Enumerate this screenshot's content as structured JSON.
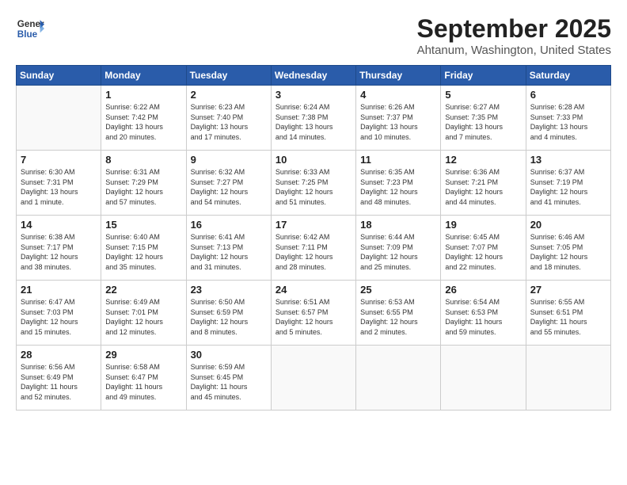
{
  "logo": {
    "general": "General",
    "blue": "Blue"
  },
  "header": {
    "title": "September 2025",
    "subtitle": "Ahtanum, Washington, United States"
  },
  "weekdays": [
    "Sunday",
    "Monday",
    "Tuesday",
    "Wednesday",
    "Thursday",
    "Friday",
    "Saturday"
  ],
  "weeks": [
    [
      {
        "day": "",
        "info": ""
      },
      {
        "day": "1",
        "info": "Sunrise: 6:22 AM\nSunset: 7:42 PM\nDaylight: 13 hours\nand 20 minutes."
      },
      {
        "day": "2",
        "info": "Sunrise: 6:23 AM\nSunset: 7:40 PM\nDaylight: 13 hours\nand 17 minutes."
      },
      {
        "day": "3",
        "info": "Sunrise: 6:24 AM\nSunset: 7:38 PM\nDaylight: 13 hours\nand 14 minutes."
      },
      {
        "day": "4",
        "info": "Sunrise: 6:26 AM\nSunset: 7:37 PM\nDaylight: 13 hours\nand 10 minutes."
      },
      {
        "day": "5",
        "info": "Sunrise: 6:27 AM\nSunset: 7:35 PM\nDaylight: 13 hours\nand 7 minutes."
      },
      {
        "day": "6",
        "info": "Sunrise: 6:28 AM\nSunset: 7:33 PM\nDaylight: 13 hours\nand 4 minutes."
      }
    ],
    [
      {
        "day": "7",
        "info": "Sunrise: 6:30 AM\nSunset: 7:31 PM\nDaylight: 13 hours\nand 1 minute."
      },
      {
        "day": "8",
        "info": "Sunrise: 6:31 AM\nSunset: 7:29 PM\nDaylight: 12 hours\nand 57 minutes."
      },
      {
        "day": "9",
        "info": "Sunrise: 6:32 AM\nSunset: 7:27 PM\nDaylight: 12 hours\nand 54 minutes."
      },
      {
        "day": "10",
        "info": "Sunrise: 6:33 AM\nSunset: 7:25 PM\nDaylight: 12 hours\nand 51 minutes."
      },
      {
        "day": "11",
        "info": "Sunrise: 6:35 AM\nSunset: 7:23 PM\nDaylight: 12 hours\nand 48 minutes."
      },
      {
        "day": "12",
        "info": "Sunrise: 6:36 AM\nSunset: 7:21 PM\nDaylight: 12 hours\nand 44 minutes."
      },
      {
        "day": "13",
        "info": "Sunrise: 6:37 AM\nSunset: 7:19 PM\nDaylight: 12 hours\nand 41 minutes."
      }
    ],
    [
      {
        "day": "14",
        "info": "Sunrise: 6:38 AM\nSunset: 7:17 PM\nDaylight: 12 hours\nand 38 minutes."
      },
      {
        "day": "15",
        "info": "Sunrise: 6:40 AM\nSunset: 7:15 PM\nDaylight: 12 hours\nand 35 minutes."
      },
      {
        "day": "16",
        "info": "Sunrise: 6:41 AM\nSunset: 7:13 PM\nDaylight: 12 hours\nand 31 minutes."
      },
      {
        "day": "17",
        "info": "Sunrise: 6:42 AM\nSunset: 7:11 PM\nDaylight: 12 hours\nand 28 minutes."
      },
      {
        "day": "18",
        "info": "Sunrise: 6:44 AM\nSunset: 7:09 PM\nDaylight: 12 hours\nand 25 minutes."
      },
      {
        "day": "19",
        "info": "Sunrise: 6:45 AM\nSunset: 7:07 PM\nDaylight: 12 hours\nand 22 minutes."
      },
      {
        "day": "20",
        "info": "Sunrise: 6:46 AM\nSunset: 7:05 PM\nDaylight: 12 hours\nand 18 minutes."
      }
    ],
    [
      {
        "day": "21",
        "info": "Sunrise: 6:47 AM\nSunset: 7:03 PM\nDaylight: 12 hours\nand 15 minutes."
      },
      {
        "day": "22",
        "info": "Sunrise: 6:49 AM\nSunset: 7:01 PM\nDaylight: 12 hours\nand 12 minutes."
      },
      {
        "day": "23",
        "info": "Sunrise: 6:50 AM\nSunset: 6:59 PM\nDaylight: 12 hours\nand 8 minutes."
      },
      {
        "day": "24",
        "info": "Sunrise: 6:51 AM\nSunset: 6:57 PM\nDaylight: 12 hours\nand 5 minutes."
      },
      {
        "day": "25",
        "info": "Sunrise: 6:53 AM\nSunset: 6:55 PM\nDaylight: 12 hours\nand 2 minutes."
      },
      {
        "day": "26",
        "info": "Sunrise: 6:54 AM\nSunset: 6:53 PM\nDaylight: 11 hours\nand 59 minutes."
      },
      {
        "day": "27",
        "info": "Sunrise: 6:55 AM\nSunset: 6:51 PM\nDaylight: 11 hours\nand 55 minutes."
      }
    ],
    [
      {
        "day": "28",
        "info": "Sunrise: 6:56 AM\nSunset: 6:49 PM\nDaylight: 11 hours\nand 52 minutes."
      },
      {
        "day": "29",
        "info": "Sunrise: 6:58 AM\nSunset: 6:47 PM\nDaylight: 11 hours\nand 49 minutes."
      },
      {
        "day": "30",
        "info": "Sunrise: 6:59 AM\nSunset: 6:45 PM\nDaylight: 11 hours\nand 45 minutes."
      },
      {
        "day": "",
        "info": ""
      },
      {
        "day": "",
        "info": ""
      },
      {
        "day": "",
        "info": ""
      },
      {
        "day": "",
        "info": ""
      }
    ]
  ]
}
